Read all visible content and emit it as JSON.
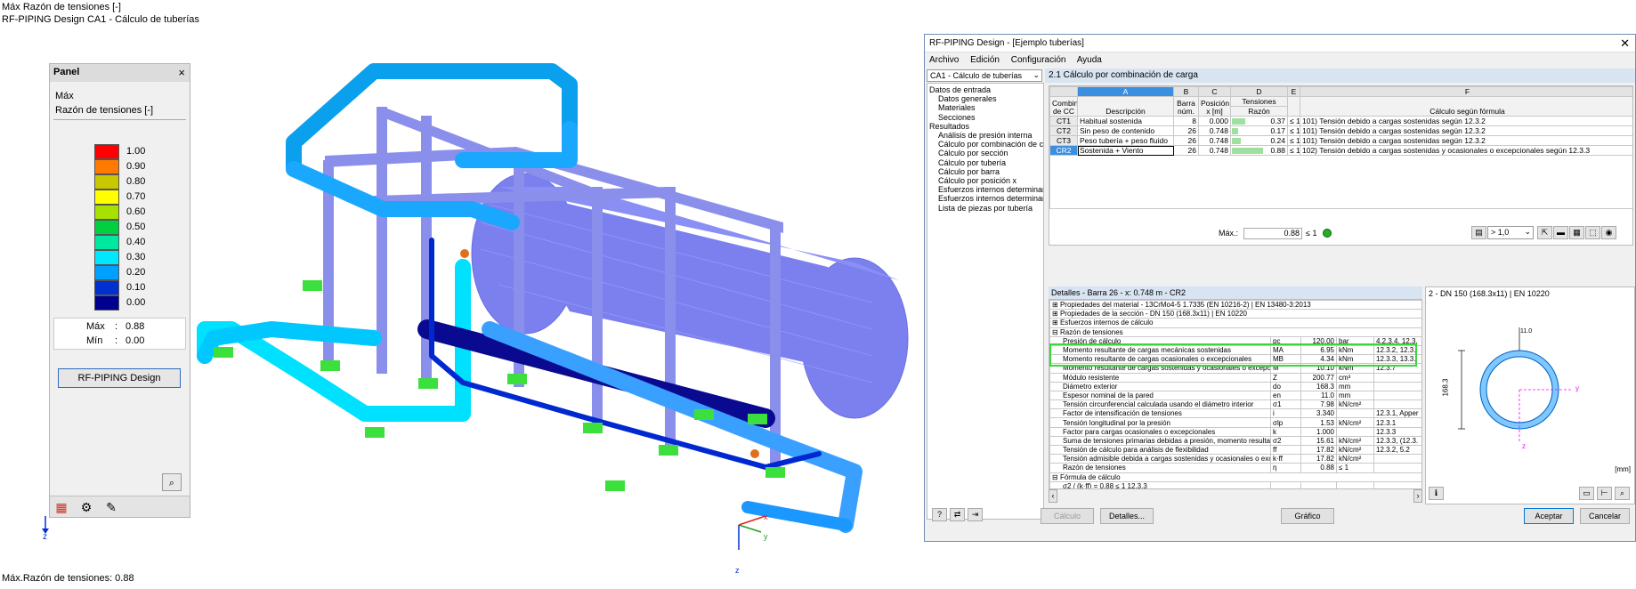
{
  "viewport": {
    "line1": "Máx Razón de tensiones [-]",
    "line2": "RF-PIPING Design CA1 - Cálculo de tuberías",
    "footer": "Máx.Razón de tensiones: 0.88",
    "axis_z": "z",
    "axis_x": "x",
    "axis_y": "y",
    "axis_z2": "z"
  },
  "panel": {
    "title": "Panel",
    "close": "×",
    "label1": "Máx",
    "label2": "Razón de tensiones [-]",
    "legend": [
      {
        "value": "1.00",
        "color": "#ff0000"
      },
      {
        "value": "0.90",
        "color": "#ff7a00"
      },
      {
        "value": "0.80",
        "color": "#c8c800"
      },
      {
        "value": "0.70",
        "color": "#ffff00"
      },
      {
        "value": "0.60",
        "color": "#a8e000"
      },
      {
        "value": "0.50",
        "color": "#00d040"
      },
      {
        "value": "0.40",
        "color": "#00e8a0"
      },
      {
        "value": "0.30",
        "color": "#00e8ff"
      },
      {
        "value": "0.20",
        "color": "#00a0ff"
      },
      {
        "value": "0.10",
        "color": "#0030d0"
      },
      {
        "value": "0.00",
        "color": "#000090"
      }
    ],
    "max_label": "Máx",
    "max_sep": ":",
    "max_value": "0.88",
    "min_label": "Mín",
    "min_sep": ":",
    "min_value": "0.00",
    "button": "RF-PIPING Design"
  },
  "dialog": {
    "title": "RF-PIPING Design - [Ejemplo tuberías]",
    "close": "✕",
    "menu": [
      "Archivo",
      "Edición",
      "Configuración",
      "Ayuda"
    ],
    "case_combo": "CA1 - Cálculo de tuberías",
    "tree": [
      {
        "label": "Datos de entrada",
        "level": 0
      },
      {
        "label": "Datos generales",
        "level": 1
      },
      {
        "label": "Materiales",
        "level": 1
      },
      {
        "label": "Secciones",
        "level": 1
      },
      {
        "label": "Resultados",
        "level": 0
      },
      {
        "label": "Análisis de presión interna",
        "level": 1
      },
      {
        "label": "Cálculo por combinación de carga",
        "level": 1
      },
      {
        "label": "Cálculo por sección",
        "level": 1
      },
      {
        "label": "Cálculo por tubería",
        "level": 1
      },
      {
        "label": "Cálculo por barra",
        "level": 1
      },
      {
        "label": "Cálculo por posición x",
        "level": 1
      },
      {
        "label": "Esfuerzos internos determinantes",
        "level": 1
      },
      {
        "label": "Esfuerzos internos determinantes",
        "level": 1
      },
      {
        "label": "Lista de piezas por tubería",
        "level": 1
      }
    ],
    "section_title": "2.1 Cálculo por combinación de carga",
    "table": {
      "letters": [
        "A",
        "B",
        "C",
        "D",
        "E",
        "F"
      ],
      "rowhdr": "Combin. de CC",
      "col_desc": "Descripción",
      "col_b": "Barra núm.",
      "col_c": "Posición x [m]",
      "col_d_top": "Tensiones",
      "col_d": "Razón",
      "col_f": "Cálculo según fórmula",
      "rows": [
        {
          "id": "CT1",
          "desc": "Habitual sostenida",
          "bar": "8",
          "x": "0.000",
          "ratio": "0.37",
          "ratio_num": 0.37,
          "le": "≤ 1",
          "formula": "101) Tensión debido a cargas sostenidas según 12.3.2",
          "selected": false
        },
        {
          "id": "CT2",
          "desc": "Sin peso de contenido",
          "bar": "26",
          "x": "0.748",
          "ratio": "0.17",
          "ratio_num": 0.17,
          "le": "≤ 1",
          "formula": "101) Tensión debido a cargas sostenidas según 12.3.2",
          "selected": false
        },
        {
          "id": "CT3",
          "desc": "Peso tubería + peso fluido",
          "bar": "26",
          "x": "0.748",
          "ratio": "0.24",
          "ratio_num": 0.24,
          "le": "≤ 1",
          "formula": "101) Tensión debido a cargas sostenidas según 12.3.2",
          "selected": false
        },
        {
          "id": "CR2",
          "desc": "Sostenida + Viento",
          "bar": "26",
          "x": "0.748",
          "ratio": "0.88",
          "ratio_num": 0.88,
          "le": "≤ 1",
          "formula": "102) Tensión debido a cargas sostenidas y ocasionales o excepcionales según 12.3.3",
          "selected": true
        }
      ],
      "max_label": "Máx.:",
      "max_value": "0.88",
      "max_le": "≤ 1",
      "filter": "> 1,0"
    },
    "details": {
      "title": "Detalles - Barra 26 - x: 0.748 m - CR2",
      "rows": [
        {
          "type": "grp",
          "sign": "⊞",
          "label": "Propiedades del material - 13CrMo4-5 1.7335 (EN 10216-2) | EN 13480-3:2013"
        },
        {
          "type": "grp",
          "sign": "⊞",
          "label": "Propiedades de la sección - DN 150 (168.3x11) | EN 10220"
        },
        {
          "type": "grp",
          "sign": "⊞",
          "label": "Esfuerzos internos de cálculo"
        },
        {
          "type": "grp",
          "sign": "⊟",
          "label": "Razón de tensiones"
        },
        {
          "type": "row",
          "label": "Presión de cálculo",
          "sym": "pc",
          "val": "120.00",
          "unit": "bar",
          "ref": "4.2.3.4, 12.3."
        },
        {
          "type": "row",
          "label": "Momento resultante de cargas mecánicas sostenidas",
          "sym": "MA",
          "val": "6.95",
          "unit": "kNm",
          "ref": "12.3.2, 12.3."
        },
        {
          "type": "row",
          "label": "Momento resultante de cargas ocasionales o excepcionales",
          "sym": "MB",
          "val": "4.34",
          "unit": "kNm",
          "ref": "12.3.3, 13.3."
        },
        {
          "type": "row",
          "label": "Momento resultante de cargas sostenidas y ocasionales o excepcionales",
          "sym": "M",
          "val": "10.10",
          "unit": "kNm",
          "ref": "12.3.7"
        },
        {
          "type": "row",
          "label": "Módulo resistente",
          "sym": "Z",
          "val": "200.77",
          "unit": "cm³",
          "ref": ""
        },
        {
          "type": "row",
          "label": "Diámetro exterior",
          "sym": "do",
          "val": "168.3",
          "unit": "mm",
          "ref": ""
        },
        {
          "type": "row",
          "label": "Espesor nominal de la pared",
          "sym": "en",
          "val": "11.0",
          "unit": "mm",
          "ref": ""
        },
        {
          "type": "row",
          "label": "Tensión circunferencial calculada usando el diámetro interior",
          "sym": "σ1",
          "val": "7.98",
          "unit": "kN/cm²",
          "ref": ""
        },
        {
          "type": "row",
          "label": "Factor de intensificación de tensiones",
          "sym": "i",
          "val": "3.340",
          "unit": "",
          "ref": "12.3.1, Apper"
        },
        {
          "type": "row",
          "label": "Tensión longitudinal por la presión",
          "sym": "σlp",
          "val": "1.53",
          "unit": "kN/cm²",
          "ref": "12.3.1"
        },
        {
          "type": "row",
          "label": "Factor para cargas ocasionales o excepcionales",
          "sym": "k",
          "val": "1.000",
          "unit": "",
          "ref": "12.3.3"
        },
        {
          "type": "row",
          "label": "Suma de tensiones primarias debidas a presión, momento resultante",
          "sym": "σ2",
          "val": "15.61",
          "unit": "kN/cm²",
          "ref": "12.3.3, (12.3."
        },
        {
          "type": "row",
          "label": "Tensión de cálculo para análisis de flexibilidad",
          "sym": "ff",
          "val": "17.82",
          "unit": "kN/cm²",
          "ref": "12.3.2, 5.2"
        },
        {
          "type": "row",
          "label": "Tensión admisible debida a cargas sostenidas y ocasionales o excep.",
          "sym": "k·ff",
          "val": "17.82",
          "unit": "kN/cm²",
          "ref": ""
        },
        {
          "type": "row",
          "label": "Razón de tensiones",
          "sym": "η",
          "val": "0.88",
          "unit": "≤ 1",
          "ref": ""
        },
        {
          "type": "grp",
          "sign": "⊟",
          "label": "Fórmula de cálculo"
        },
        {
          "type": "row",
          "label": "σ2 / (k·ff) = 0.88 ≤ 1   12.3.3",
          "sym": "",
          "val": "",
          "unit": "",
          "ref": ""
        }
      ]
    },
    "section_preview": {
      "title": "2 - DN 150 (168.3x11) | EN 10220",
      "unit": "[mm]",
      "dim_h": "168.3",
      "dim_t": "11.0",
      "ax_y": "y",
      "ax_z": "z"
    },
    "buttons": {
      "calc": "Cálculo",
      "details": "Detalles...",
      "graphic": "Gráfico",
      "ok": "Aceptar",
      "cancel": "Cancelar"
    }
  }
}
